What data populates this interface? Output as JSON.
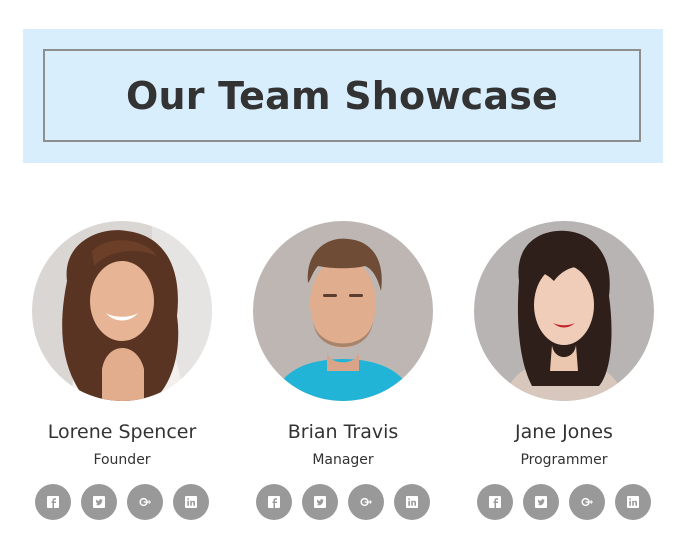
{
  "header": {
    "title": "Our Team Showcase",
    "band_color": "#d8eefc"
  },
  "members": [
    {
      "name": "Lorene Spencer",
      "role": "Founder",
      "socials": [
        "facebook-icon",
        "twitter-icon",
        "google-plus-icon",
        "linkedin-icon"
      ]
    },
    {
      "name": "Brian Travis",
      "role": "Manager",
      "socials": [
        "facebook-icon",
        "twitter-icon",
        "google-plus-icon",
        "linkedin-icon"
      ]
    },
    {
      "name": "Jane Jones",
      "role": "Programmer",
      "socials": [
        "facebook-icon",
        "twitter-icon",
        "google-plus-icon",
        "linkedin-icon"
      ]
    }
  ],
  "colors": {
    "social_bg": "#999999",
    "text": "#333333"
  }
}
